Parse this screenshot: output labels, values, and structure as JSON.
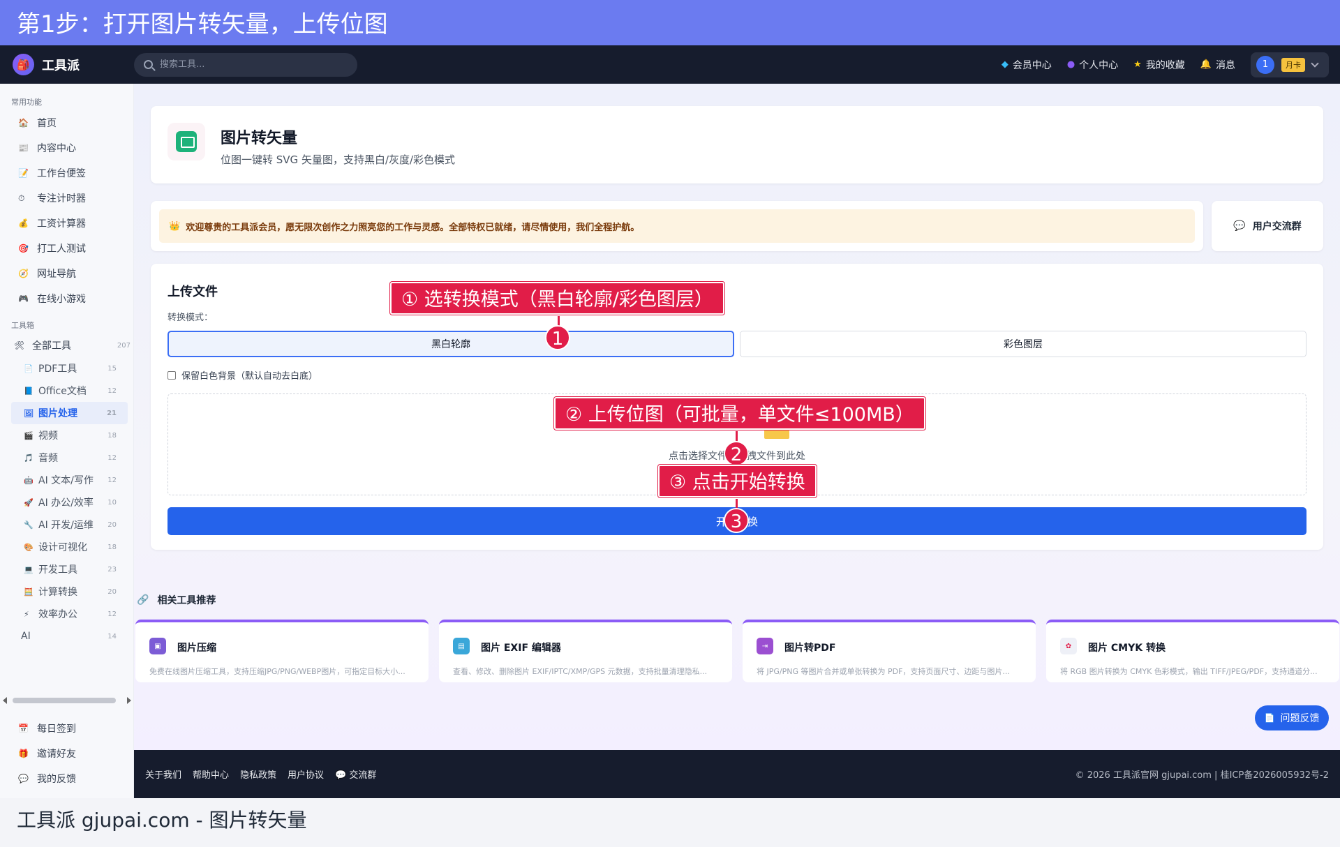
{
  "banner": {
    "title": "第1步：打开图片转矢量，上传位图"
  },
  "navbar": {
    "logo_text": "工具派",
    "search_placeholder": "搜索工具...",
    "links": [
      {
        "label": "会员中心",
        "icon": "diamond-icon"
      },
      {
        "label": "个人中心",
        "icon": "user-icon"
      },
      {
        "label": "我的收藏",
        "icon": "star-icon"
      },
      {
        "label": "消息",
        "icon": "bell-icon"
      }
    ],
    "user": {
      "avatar_text": "1",
      "badge": "月卡"
    }
  },
  "sidebar": {
    "common_title": "常用功能",
    "common_items": [
      {
        "label": "首页",
        "icon": "🏠"
      },
      {
        "label": "内容中心",
        "icon": "📰"
      },
      {
        "label": "工作台便签",
        "icon": "📝"
      },
      {
        "label": "专注计时器",
        "icon": "⏱"
      },
      {
        "label": "工资计算器",
        "icon": "💰"
      },
      {
        "label": "打工人测试",
        "icon": "🎯"
      },
      {
        "label": "网址导航",
        "icon": "🧭"
      },
      {
        "label": "在线小游戏",
        "icon": "🎮"
      }
    ],
    "toolbox_title": "工具箱",
    "all_tools": {
      "label": "全部工具",
      "count": "207",
      "icon": "🛠"
    },
    "categories": [
      {
        "label": "PDF工具",
        "count": "15",
        "icon": "📄"
      },
      {
        "label": "Office文档",
        "count": "12",
        "icon": "📘"
      },
      {
        "label": "图片处理",
        "count": "21",
        "icon": "🖼",
        "active": true
      },
      {
        "label": "视频",
        "count": "18",
        "icon": "🎬"
      },
      {
        "label": "音频",
        "count": "12",
        "icon": "🎵"
      },
      {
        "label": "AI 文本/写作",
        "count": "12",
        "icon": "🤖"
      },
      {
        "label": "AI 办公/效率",
        "count": "10",
        "icon": "🚀"
      },
      {
        "label": "AI 开发/运维",
        "count": "20",
        "icon": "🔧"
      },
      {
        "label": "设计可视化",
        "count": "18",
        "icon": "🎨"
      },
      {
        "label": "开发工具",
        "count": "23",
        "icon": "💻"
      },
      {
        "label": "计算转换",
        "count": "20",
        "icon": "🧮"
      },
      {
        "label": "效率办公",
        "count": "12",
        "icon": "⚡"
      },
      {
        "label": "AI",
        "count": "14",
        "icon": ""
      }
    ],
    "bottom_items": [
      {
        "label": "每日签到",
        "icon": "📅"
      },
      {
        "label": "邀请好友",
        "icon": "🎁"
      },
      {
        "label": "我的反馈",
        "icon": "💬"
      }
    ]
  },
  "tool": {
    "title": "图片转矢量",
    "description": "位图一键转 SVG 矢量图，支持黑白/灰度/彩色模式"
  },
  "welcome": {
    "text": "欢迎尊贵的工具派会员，愿无限次创作之力照亮您的工作与灵感。全部特权已就绪，请尽情使用，我们全程护航。",
    "icon": "👑"
  },
  "group": {
    "label": "用户交流群"
  },
  "upload": {
    "title": "上传文件",
    "mode_label": "转换模式：",
    "modes": [
      "黑白轮廓",
      "彩色图层"
    ],
    "selected_mode": "黑白轮廓",
    "keep_bg_label": "保留白色背景（默认自动去白底）",
    "keep_bg_checked": false,
    "drop_text": "点击选择文件或拖拽文件到此处",
    "start_label": "开始转换"
  },
  "related": {
    "title": "相关工具推荐",
    "items": [
      {
        "name": "图片压缩",
        "desc": "免费在线图片压缩工具，支持压缩JPG/PNG/WEBP图片，可指定目标大小...",
        "color": "#7c5cd6"
      },
      {
        "name": "图片 EXIF 编辑器",
        "desc": "查看、修改、删除图片 EXIF/IPTC/XMP/GPS 元数据，支持批量清理隐私...",
        "color": "#3aa7d9"
      },
      {
        "name": "图片转PDF",
        "desc": "将 JPG/PNG 等图片合并或单张转换为 PDF，支持页面尺寸、边距与图片...",
        "color": "#9b4fd1"
      },
      {
        "name": "图片 CMYK 转换",
        "desc": "将 RGB 图片转换为 CMYK 色彩模式，输出 TIFF/JPEG/PDF，支持通道分...",
        "color": "#e8eaf3"
      }
    ]
  },
  "feedback": {
    "label": "问题反馈"
  },
  "footer": {
    "links": [
      "关于我们",
      "帮助中心",
      "隐私政策",
      "用户协议",
      "交流群"
    ],
    "copyright": "© 2026 工具派官网 gjupai.com | 桂ICP备2026005932号-2"
  },
  "bottom_caption": "工具派 gjupai.com - 图片转矢量",
  "annotations": [
    {
      "text": "① 选转换模式（黑白轮廓/彩色图层）",
      "num": "1"
    },
    {
      "text": "② 上传位图（可批量，单文件≤100MB）",
      "num": "2"
    },
    {
      "text": "③ 点击开始转换",
      "num": "3"
    }
  ]
}
